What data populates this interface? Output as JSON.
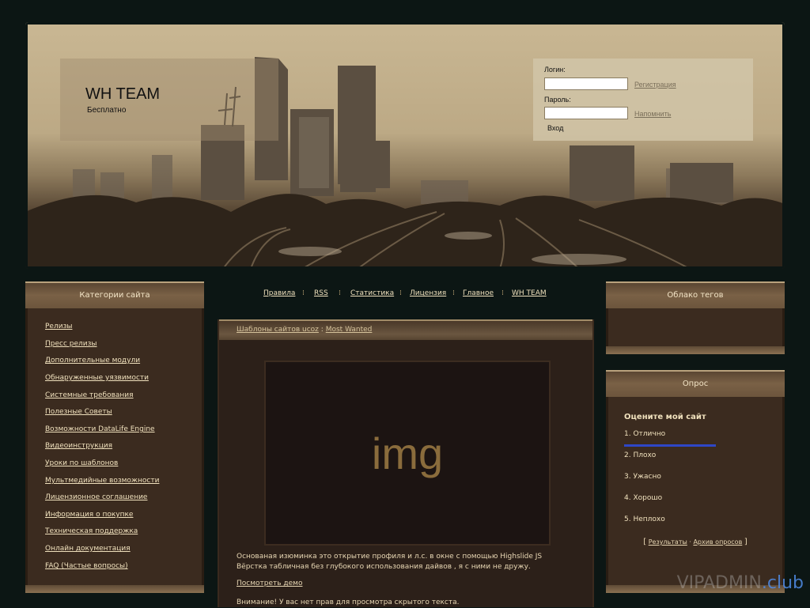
{
  "header": {
    "site_title": "WH TEAM",
    "site_subtitle": "Бесплатно",
    "login": {
      "login_label": "Логин:",
      "password_label": "Пароль:",
      "register_link": "Регистрация",
      "remind_link": "Напомнить",
      "submit_label": "Вход"
    }
  },
  "left_panel": {
    "title": "Категории сайта",
    "items": [
      "Релизы",
      "Пресс релизы",
      "Дополнительные модули",
      "Обнаруженные уязвимости",
      "Системные требования",
      "Полезные Советы",
      "Возможности DataLife Engine",
      "Видеоинструкция",
      "Уроки по шаблонов",
      "Мультмедийные возможности",
      "Лицензионное соглашение",
      "Информация о покупке",
      "Техническая поддержка",
      "Онлайн документация",
      "FAQ (Частые вопросы)"
    ]
  },
  "nav": {
    "items": [
      "Правила",
      "RSS",
      "Статистика",
      "Лицензия",
      "Главное",
      "WH TEAM"
    ]
  },
  "content": {
    "breadcrumb": [
      "Шаблоны сайтов ucoz",
      "Most Wanted"
    ],
    "breadcrumb_sep": ":",
    "image_placeholder": "img",
    "description_line1": "Основаная изюминка это открытие профиля и л.с. в окне с помощью Highslide JS",
    "description_line2": "Вёрстка табличная без глубокого использования дайвов , я с ними не дружу.",
    "demo_link": "Посмотреть демо",
    "warning": "Внимание! У вас нет прав для просмотра скрытого текста."
  },
  "tag_cloud": {
    "title": "Облако тегов"
  },
  "poll": {
    "title": "Опрос",
    "question": "Оцените мой сайт",
    "options": [
      "1. Отлично",
      "2. Плохо",
      "3. Ужасно",
      "4. Хорошо",
      "5. Неплохо"
    ],
    "results_link": "Результаты",
    "archive_link": "Архив опросов",
    "bracket_open": "[",
    "bracket_close": "]",
    "dot": "·"
  },
  "watermark": {
    "main": "VIPADMIN",
    "suffix": ".club"
  },
  "colors": {
    "page_background": "#0c1614",
    "panel_background": "#3b2b1f",
    "link_text": "#f0e1bd",
    "poll_bar": "#2e47c6",
    "image_text": "#8a6c3c"
  }
}
